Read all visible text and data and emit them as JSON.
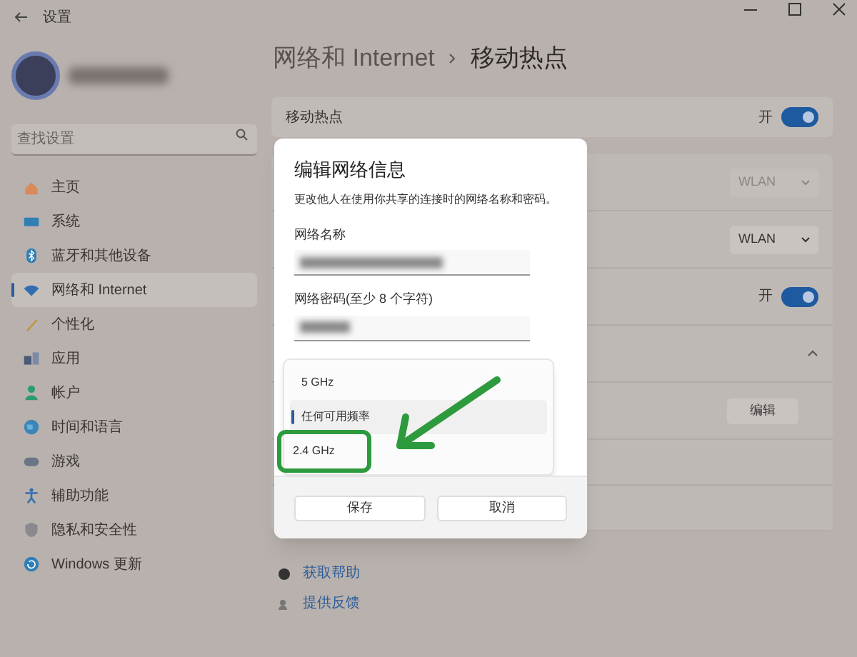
{
  "window": {
    "title": "设置"
  },
  "sidebar": {
    "search": {
      "placeholder": "查找设置"
    },
    "items": [
      {
        "label": "主页",
        "selected": false
      },
      {
        "label": "系统",
        "selected": false
      },
      {
        "label": "蓝牙和其他设备",
        "selected": false
      },
      {
        "label": "网络和 Internet",
        "selected": true
      },
      {
        "label": "个性化",
        "selected": false
      },
      {
        "label": "应用",
        "selected": false
      },
      {
        "label": "帐户",
        "selected": false
      },
      {
        "label": "时间和语言",
        "selected": false
      },
      {
        "label": "游戏",
        "selected": false
      },
      {
        "label": "辅助功能",
        "selected": false
      },
      {
        "label": "隐私和安全性",
        "selected": false
      },
      {
        "label": "Windows 更新",
        "selected": false
      }
    ]
  },
  "breadcrumb": {
    "parent": "网络和 Internet",
    "current": "移动热点"
  },
  "hotspot": {
    "label": "移动热点",
    "state_text": "开",
    "on": true
  },
  "settings_rows": [
    {
      "kind": "dropdown",
      "value": "WLAN",
      "disabled": true
    },
    {
      "kind": "dropdown",
      "value": "WLAN",
      "disabled": false
    },
    {
      "kind": "toggle",
      "state_text": "开",
      "on": true
    },
    {
      "kind": "expander",
      "expanded": true
    },
    {
      "kind": "button",
      "label": "编辑"
    },
    {
      "kind": "blank"
    },
    {
      "kind": "blank"
    }
  ],
  "footer_links": [
    {
      "label": "获取帮助"
    },
    {
      "label": "提供反馈"
    }
  ],
  "dialog": {
    "title": "编辑网络信息",
    "description": "更改他人在使用你共享的连接时的网络名称和密码。",
    "fields": [
      {
        "label": "网络名称"
      },
      {
        "label": "网络密码(至少 8 个字符)"
      }
    ],
    "band_options": [
      {
        "label": "5 GHz",
        "selected": false,
        "highlighted": false
      },
      {
        "label": "任何可用频率",
        "selected": true,
        "highlighted": false
      },
      {
        "label": "2.4 GHz",
        "selected": false,
        "highlighted": true
      }
    ],
    "buttons": [
      "保存",
      "取消"
    ]
  }
}
